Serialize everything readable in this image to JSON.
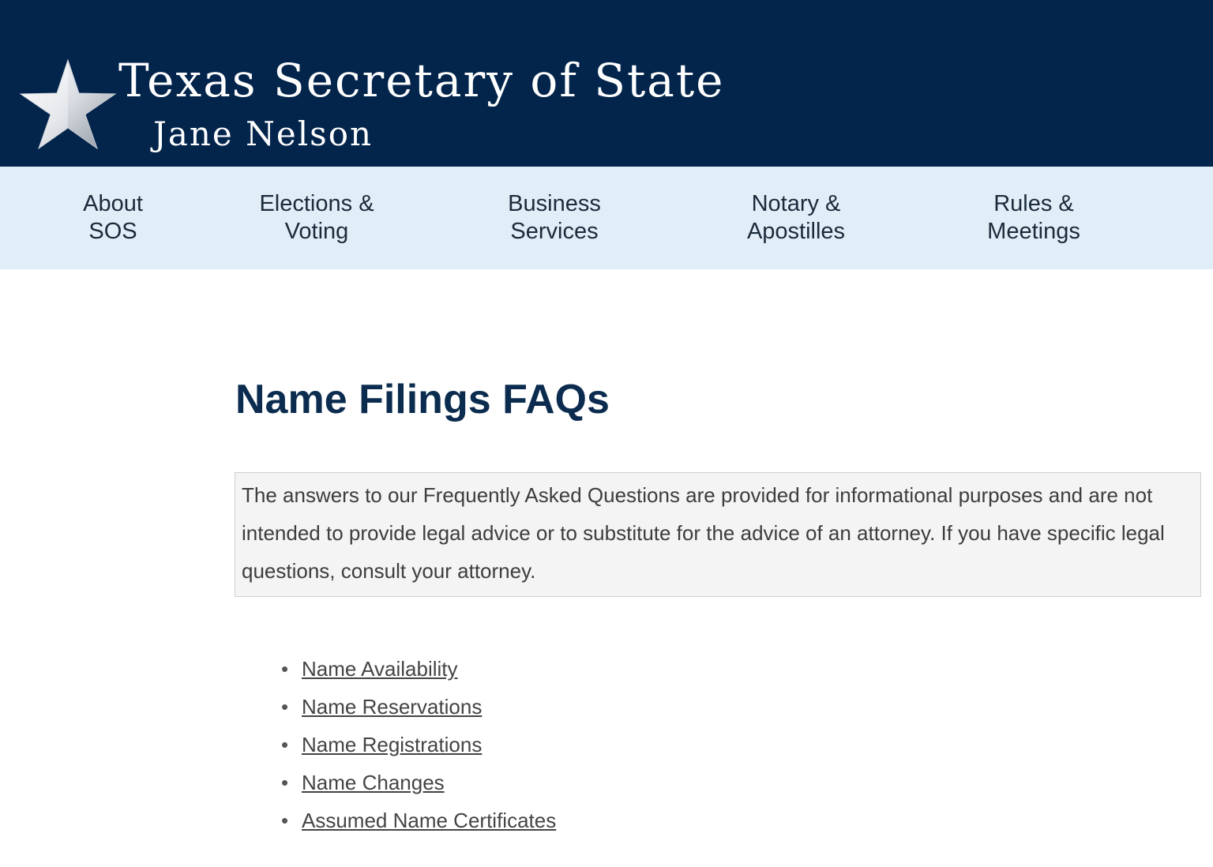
{
  "header": {
    "title": "Texas Secretary of State",
    "subtitle": "Jane Nelson",
    "logo_icon": "star-icon",
    "background_color": "#03254c"
  },
  "nav": {
    "background_color": "#e1eef8",
    "items": [
      {
        "line1": "About",
        "line2": "SOS"
      },
      {
        "line1": "Elections &",
        "line2": "Voting"
      },
      {
        "line1": "Business",
        "line2": "Services"
      },
      {
        "line1": "Notary &",
        "line2": "Apostilles"
      },
      {
        "line1": "Rules &",
        "line2": "Meetings"
      }
    ]
  },
  "main": {
    "title": "Name Filings FAQs",
    "disclaimer": "The answers to our Frequently Asked Questions are provided for informational purposes and are not intended to provide legal advice or to substitute for the advice of an attorney. If you have specific legal questions, consult your attorney.",
    "links": [
      "Name Availability",
      "Name Reservations",
      "Name Registrations",
      "Name Changes",
      "Assumed Name Certificates"
    ]
  }
}
